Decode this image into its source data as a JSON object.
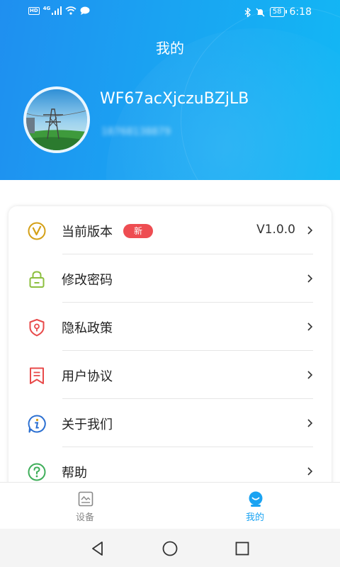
{
  "status_bar": {
    "left_badge": "HD",
    "network": "4G",
    "battery": "58",
    "time": "6:18"
  },
  "header": {
    "title": "我的",
    "username": "WF67acXjczuBZjLB",
    "phone": "18768138879"
  },
  "menu": [
    {
      "label": "当前版本",
      "badge": "新",
      "value": "V1.0.0",
      "icon": "version-icon",
      "color": "#d4a017"
    },
    {
      "label": "修改密码",
      "icon": "lock-icon",
      "color": "#8cbf3f"
    },
    {
      "label": "隐私政策",
      "icon": "privacy-shield-icon",
      "color": "#e84a4a"
    },
    {
      "label": "用户协议",
      "icon": "agreement-bookmark-icon",
      "color": "#e84a4a"
    },
    {
      "label": "关于我们",
      "icon": "about-info-icon",
      "color": "#2b6fd1"
    },
    {
      "label": "帮助",
      "icon": "help-question-icon",
      "color": "#3fae5a"
    }
  ],
  "tabbar": [
    {
      "label": "设备",
      "icon": "device-icon",
      "active": false,
      "color": "#888888"
    },
    {
      "label": "我的",
      "icon": "profile-icon",
      "active": true,
      "color": "#1aa3f2"
    }
  ],
  "navbar": {
    "buttons": [
      "back-icon",
      "home-icon",
      "recents-icon"
    ]
  }
}
